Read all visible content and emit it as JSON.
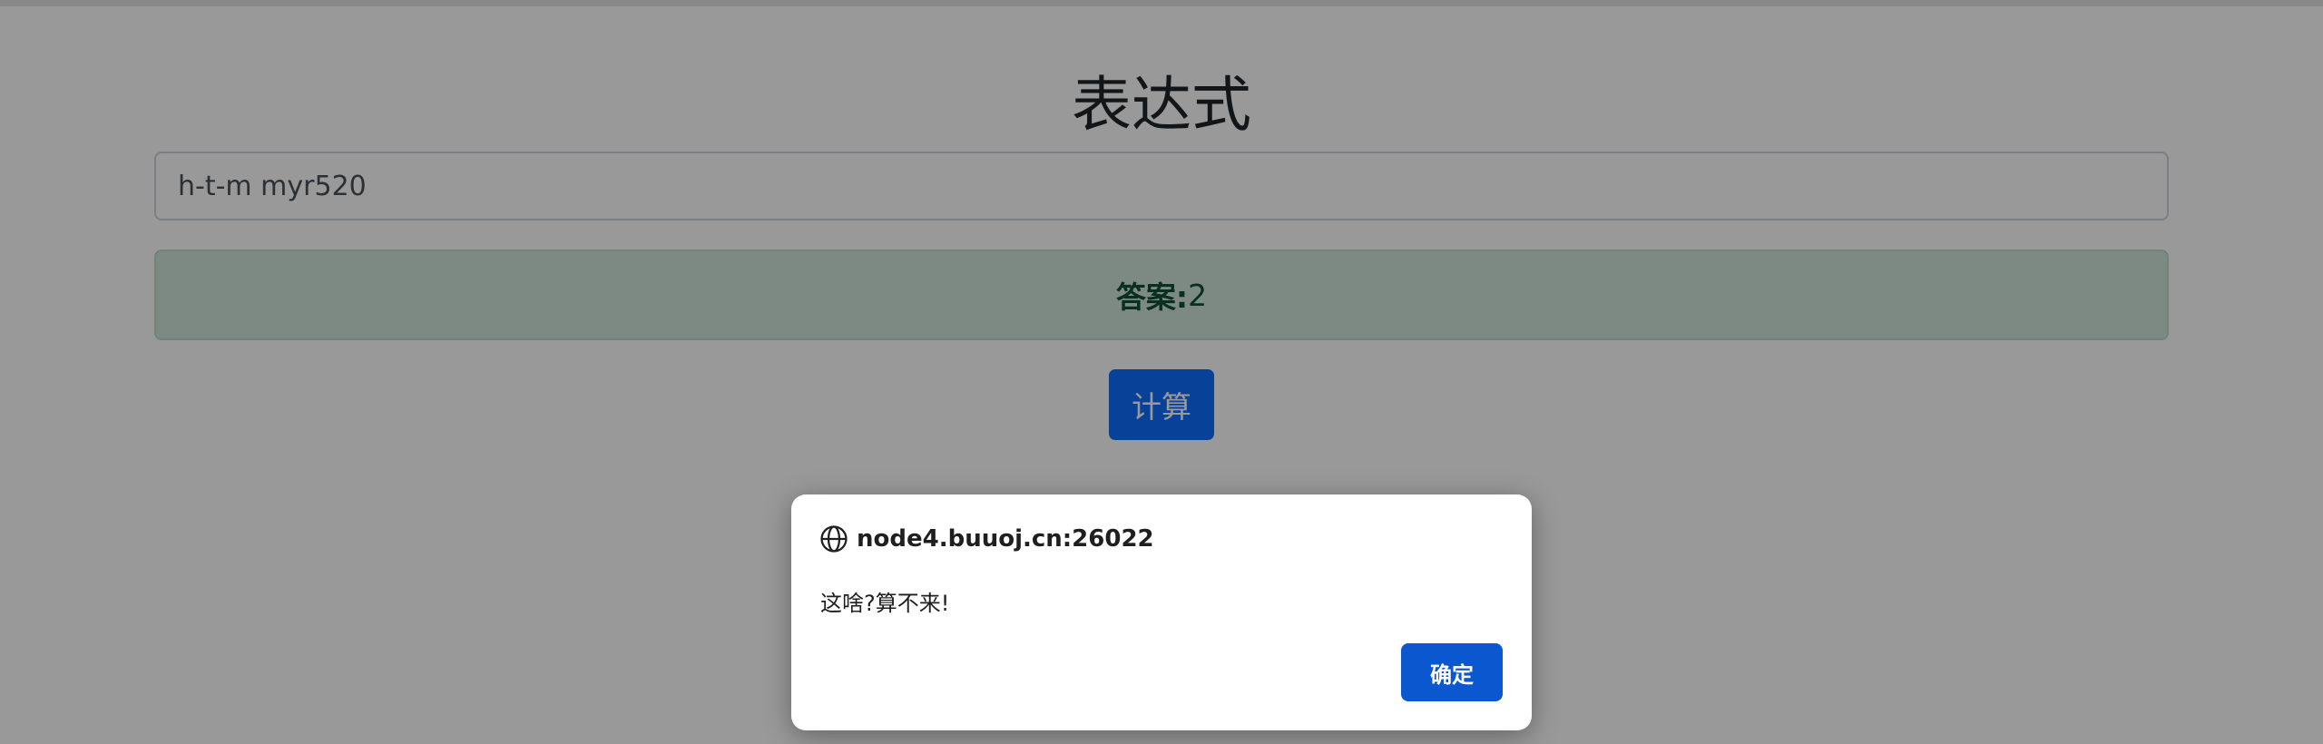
{
  "page": {
    "title": "表达式"
  },
  "expression": {
    "value": "h-t-m myr520"
  },
  "answer": {
    "label": "答案:",
    "value": "2"
  },
  "calculate_button": {
    "label": "计算"
  },
  "dialog": {
    "origin": "node4.buuoj.cn:26022",
    "message": "这啥?算不来!",
    "ok_label": "确定",
    "icon": "globe-icon"
  },
  "colors": {
    "primary": "#0d6efd",
    "success_bg": "#d1e7dd",
    "success_text": "#0f5132",
    "dialog_button": "#0b57d0"
  }
}
